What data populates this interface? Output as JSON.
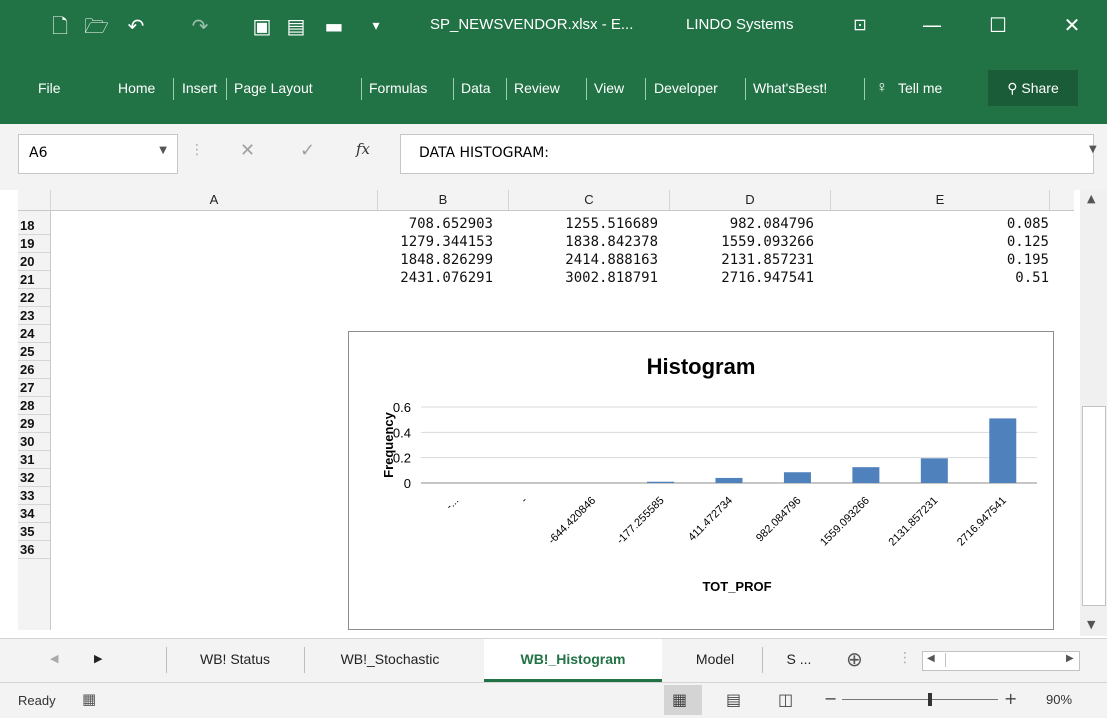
{
  "titlebar": {
    "doc_title": "SP_NEWSVENDOR.xlsx - E...",
    "company": "LINDO Systems"
  },
  "menu": {
    "items": [
      "File",
      "Home",
      "Insert",
      "Page Layout",
      "Formulas",
      "Data",
      "Review",
      "View",
      "Developer",
      "What'sBest!",
      "Tell me"
    ],
    "share": "Share"
  },
  "formula_bar": {
    "cell_ref": "A6",
    "fx": "fx",
    "value": "DATA HISTOGRAM:"
  },
  "grid": {
    "columns": [
      "A",
      "B",
      "C",
      "D",
      "E"
    ],
    "rows": [
      "18",
      "19",
      "20",
      "21",
      "22",
      "23",
      "24",
      "25",
      "26",
      "27",
      "28",
      "29",
      "30",
      "31",
      "32",
      "33",
      "34",
      "35",
      "36"
    ],
    "data": [
      {
        "b": "708.652903",
        "c": "1255.516689",
        "d": "982.084796",
        "e": "0.085"
      },
      {
        "b": "1279.344153",
        "c": "1838.842378",
        "d": "1559.093266",
        "e": "0.125"
      },
      {
        "b": "1848.826299",
        "c": "2414.888163",
        "d": "2131.857231",
        "e": "0.195"
      },
      {
        "b": "2431.076291",
        "c": "3002.818791",
        "d": "2716.947541",
        "e": "0.51"
      }
    ]
  },
  "chart_data": {
    "type": "bar",
    "title": "Histogram",
    "xlabel": "TOT_PROF",
    "ylabel": "Frequency",
    "ylim": [
      0,
      0.6
    ],
    "yticks": [
      "0",
      "0.2",
      "0.4",
      "0.6"
    ],
    "categories": [
      "-...",
      "-",
      "-644.420846",
      "-177.255585",
      "411.472734",
      "982.084796",
      "1559.093266",
      "2131.857231",
      "2716.947541"
    ],
    "values": [
      0,
      0,
      0,
      0.01,
      0.04,
      0.085,
      0.125,
      0.195,
      0.51
    ],
    "color": "#4f81bd"
  },
  "sheets": {
    "tabs": [
      "WB! Status",
      "WB!_Stochastic",
      "WB!_Histogram",
      "Model",
      "S ..."
    ],
    "active": "WB!_Histogram"
  },
  "status": {
    "ready": "Ready",
    "zoom": "90%"
  },
  "colors": {
    "excel_green": "#217346",
    "active_tab_text": "#217346"
  }
}
